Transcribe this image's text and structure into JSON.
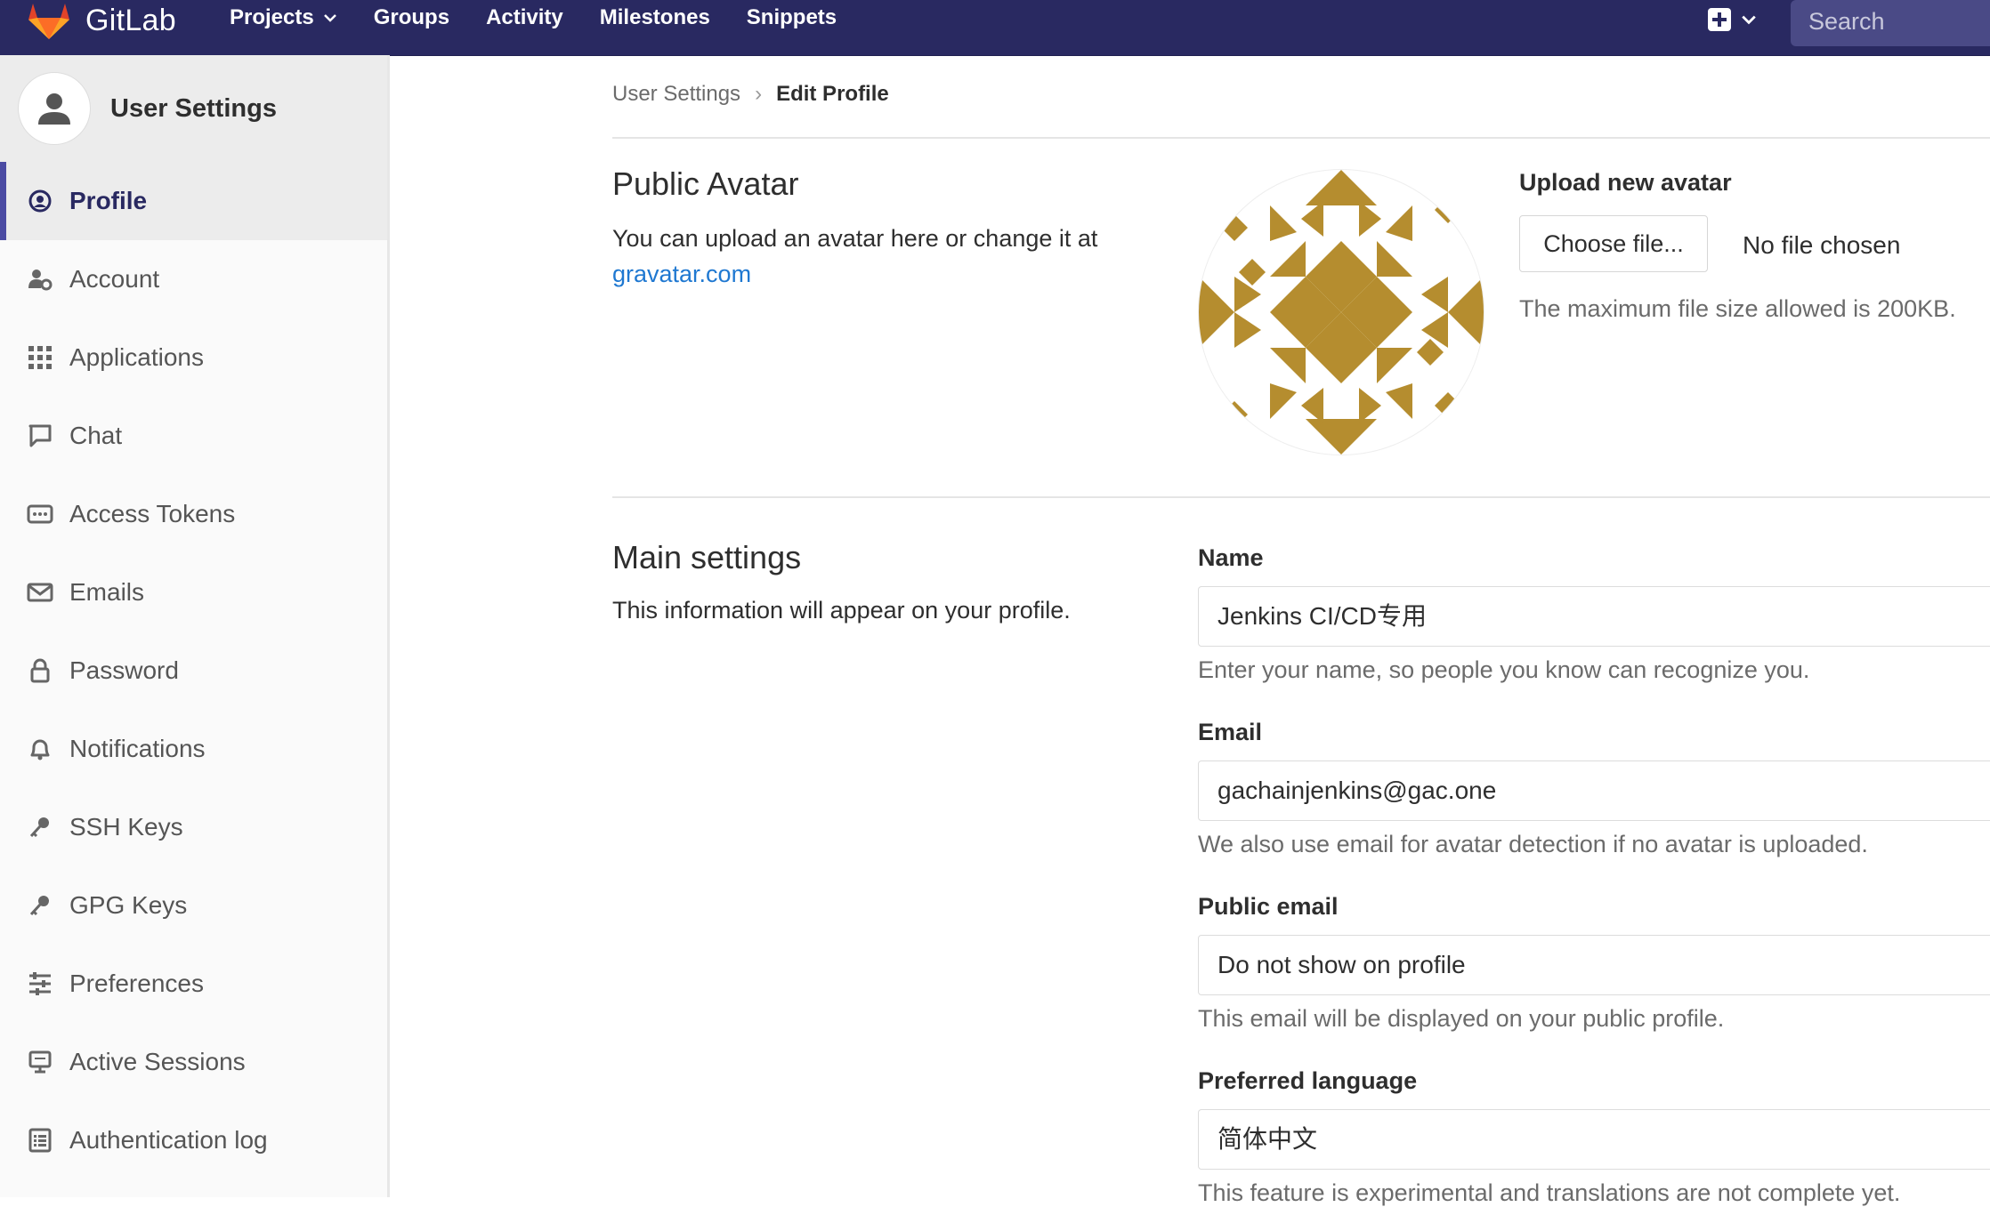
{
  "topbar": {
    "logo_text": "GitLab",
    "nav": [
      {
        "label": "Projects",
        "has_dropdown": true
      },
      {
        "label": "Groups"
      },
      {
        "label": "Activity"
      },
      {
        "label": "Milestones"
      },
      {
        "label": "Snippets"
      }
    ],
    "search_placeholder": "Search",
    "colors": {
      "bar": "#292961",
      "logo_orange": "#e24329"
    }
  },
  "sidebar": {
    "title": "User Settings",
    "items": [
      {
        "label": "Profile",
        "icon": "profile-icon",
        "active": true
      },
      {
        "label": "Account",
        "icon": "account-icon"
      },
      {
        "label": "Applications",
        "icon": "applications-icon"
      },
      {
        "label": "Chat",
        "icon": "chat-icon"
      },
      {
        "label": "Access Tokens",
        "icon": "access-tokens-icon"
      },
      {
        "label": "Emails",
        "icon": "emails-icon"
      },
      {
        "label": "Password",
        "icon": "lock-icon"
      },
      {
        "label": "Notifications",
        "icon": "bell-icon"
      },
      {
        "label": "SSH Keys",
        "icon": "key-icon"
      },
      {
        "label": "GPG Keys",
        "icon": "key-icon"
      },
      {
        "label": "Preferences",
        "icon": "preferences-icon"
      },
      {
        "label": "Active Sessions",
        "icon": "monitor-icon"
      },
      {
        "label": "Authentication log",
        "icon": "log-icon"
      }
    ]
  },
  "breadcrumb": {
    "parent": "User Settings",
    "current": "Edit Profile"
  },
  "avatar_section": {
    "title": "Public Avatar",
    "description": "You can upload an avatar here or change it at",
    "link_text": "gravatar.com",
    "upload_label": "Upload new avatar",
    "choose_button": "Choose file...",
    "no_file": "No file chosen",
    "max_size": "The maximum file size allowed is 200KB.",
    "avatar_color": "#b58d2f"
  },
  "main_settings": {
    "title": "Main settings",
    "description": "This information will appear on your profile.",
    "name": {
      "label": "Name",
      "value": "Jenkins CI/CD专用",
      "help": "Enter your name, so people you know can recognize you."
    },
    "email": {
      "label": "Email",
      "value": "gachainjenkins@gac.one",
      "help": "We also use email for avatar detection if no avatar is uploaded."
    },
    "public_email": {
      "label": "Public email",
      "value": "Do not show on profile",
      "help": "This email will be displayed on your public profile."
    },
    "preferred_language": {
      "label": "Preferred language",
      "value": "简体中文",
      "help": "This feature is experimental and translations are not complete yet."
    }
  }
}
